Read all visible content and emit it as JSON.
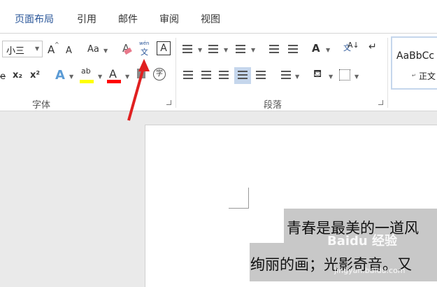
{
  "tabs": [
    "页面布局",
    "引用",
    "邮件",
    "审阅",
    "视图"
  ],
  "font_group": {
    "size_value": "小三",
    "grow_label": "A",
    "shrink_label": "A",
    "case_label": "Aa",
    "pinyin_top": "wén",
    "pinyin_char": "文",
    "border_char": "A",
    "subscript": "x₂",
    "superscript": "x²",
    "effects_char": "A",
    "highlight_char": "ab",
    "color_char": "A",
    "enclose_char": "字",
    "label": "字体"
  },
  "paragraph_group": {
    "label": "段落"
  },
  "styles": {
    "preview": "AaBbCc",
    "name": "正文"
  },
  "colors": {
    "accent": "#2b579a",
    "highlight": "#ffff00",
    "font_color": "#ff0000",
    "arrow": "#e02020"
  },
  "document": {
    "line1": "青春是最美的一道风",
    "line2": "绚丽的画；光影奇音。又"
  },
  "watermark": {
    "brand": "Baidu 经验",
    "url": "jingyan.baidu.com"
  }
}
